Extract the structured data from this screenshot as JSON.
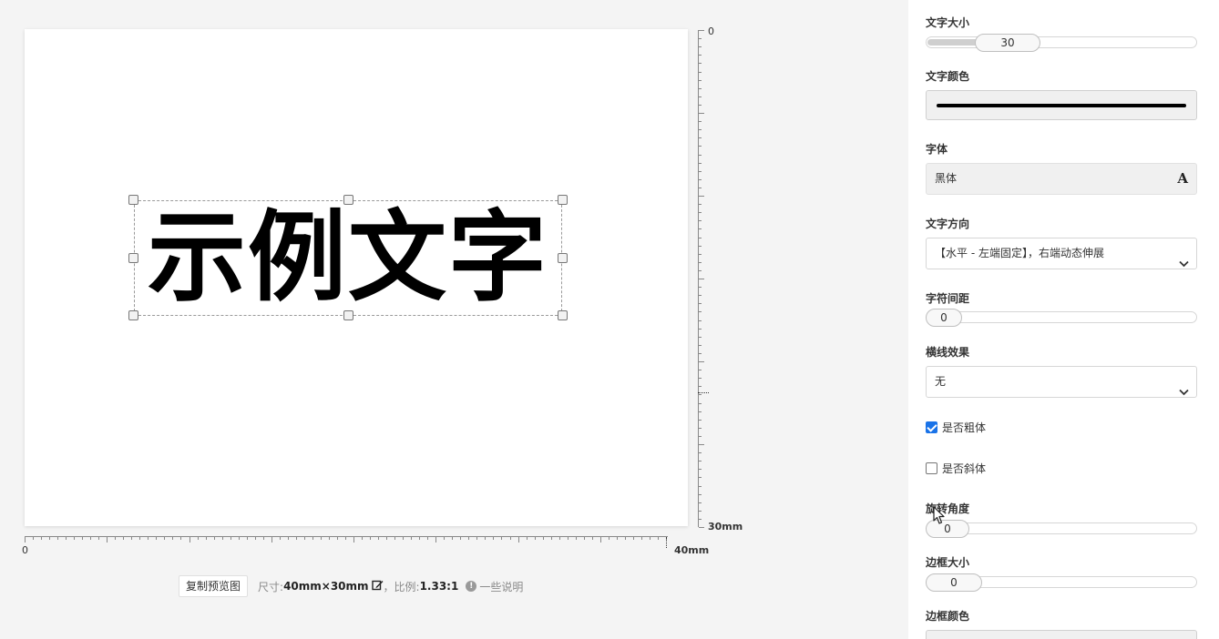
{
  "canvas": {
    "sample_text": "示例文字"
  },
  "rulers": {
    "vertical_start": "0",
    "vertical_end": "30mm",
    "horizontal_start": "0",
    "horizontal_end": "40mm"
  },
  "info_bar": {
    "copy_button": "复制预览图",
    "size_label": "尺寸:",
    "size_value": "40mm×30mm",
    "ratio_label": "，比例:",
    "ratio_value": "1.33:1",
    "info_icon": "!",
    "note": "一些说明",
    "icons": {
      "edit": "edit-icon",
      "info": "info-icon"
    }
  },
  "panel": {
    "font_size": {
      "label": "文字大小",
      "value": "30",
      "fraction": 0.18
    },
    "text_color": {
      "label": "文字颜色",
      "color": "#000000"
    },
    "font_family": {
      "label": "字体",
      "value": "黑体",
      "icon": "A"
    },
    "text_direction": {
      "label": "文字方向",
      "value": "【水平 - 左端固定】，右端动态伸展"
    },
    "char_spacing": {
      "label": "字符间距",
      "value": "0",
      "fraction": 0
    },
    "line_effect": {
      "label": "横线效果",
      "value": "无"
    },
    "bold": {
      "label": "是否粗体",
      "checked": true
    },
    "italic": {
      "label": "是否斜体",
      "checked": false
    },
    "rotation": {
      "label": "旋转角度",
      "value": "0",
      "fraction": 0
    },
    "border_size": {
      "label": "边框大小",
      "value": "0",
      "fraction": 0
    },
    "border_color": {
      "label": "边框颜色"
    }
  },
  "colors": {
    "accent": "#1a73e8",
    "canvas_bg": "#ffffff",
    "page_bg": "#f4f4f4"
  }
}
